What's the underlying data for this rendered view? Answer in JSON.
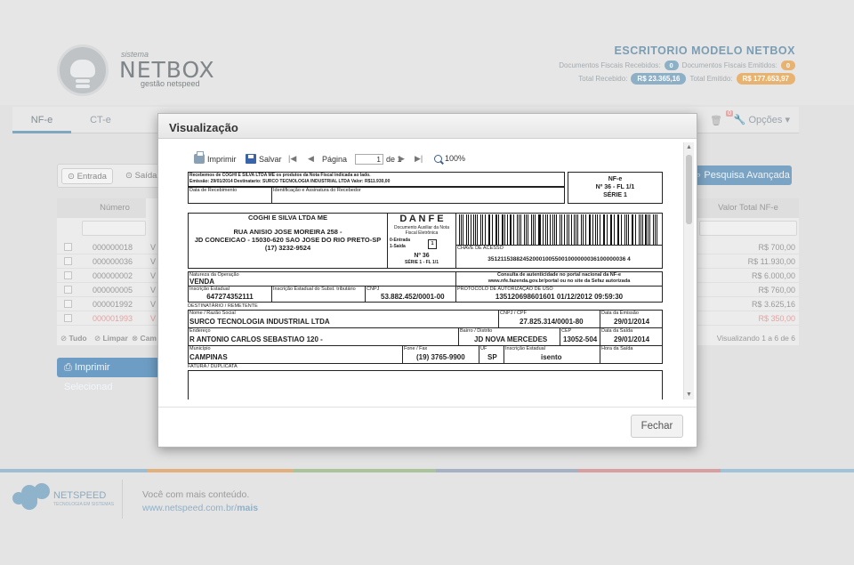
{
  "brand": {
    "small": "sistema",
    "name": "NETBOX",
    "sub": "gestão netspeed"
  },
  "office": {
    "title": "ESCRITORIO MODELO NETBOX",
    "docs_received_label": "Documentos Fiscais Recebidos:",
    "docs_received": "0",
    "docs_issued_label": "Documentos Fiscais Emitidos:",
    "docs_issued": "0",
    "total_received_label": "Total Recebido:",
    "total_received": "R$ 23.365,16",
    "total_issued_label": "Total Emitido:",
    "total_issued": "R$ 177.653,97"
  },
  "nav": {
    "tabs": [
      "NF-e",
      "CT-e"
    ],
    "options": "Opções",
    "badge": "0"
  },
  "filters": {
    "entrada": "Entrada",
    "saida": "Saída",
    "advanced": "Pesquisa Avançada"
  },
  "table": {
    "col_numero": "Número",
    "col_valor": "Valor Total NF-e",
    "rows": [
      {
        "num": "000000018",
        "v": "V",
        "val": "R$ 700,00",
        "red": false
      },
      {
        "num": "000000036",
        "v": "V",
        "val": "R$ 11.930,00",
        "red": false
      },
      {
        "num": "000000002",
        "v": "V",
        "val": "R$ 6.000,00",
        "red": false
      },
      {
        "num": "000000005",
        "v": "V",
        "val": "R$ 760,00",
        "red": false
      },
      {
        "num": "000001992",
        "v": "V",
        "val": "R$ 3.625,16",
        "red": false
      },
      {
        "num": "000001993",
        "v": "V",
        "val": "R$ 350,00",
        "red": true
      }
    ],
    "footer_tudo": "Tudo",
    "footer_limpar": "Limpar",
    "footer_cam": "Cam",
    "showing": "Visualizando 1 a 6 de 6",
    "print_selected": "Imprimir Selecionad"
  },
  "footer": {
    "brand": "NETSPEED",
    "tagline": "TECNOLOGIA EM SISTEMAS",
    "text": "Você com mais conteúdo.",
    "link_plain": "www.netspeed.com.br/",
    "link_bold": "mais"
  },
  "modal": {
    "title": "Visualização",
    "close": "Fechar",
    "toolbar": {
      "print": "Imprimir",
      "save": "Salvar",
      "page_label": "Página",
      "page_value": "1",
      "of": "de 1",
      "zoom": "100%"
    }
  },
  "danfe": {
    "receipt_line1": "Recebemos de COGHI E SILVA LTDA ME os produtos da Nota Fiscal indicada ao lado.",
    "receipt_line2": "Emissão: 29/01/2014 Destinatario: SURCO TECNOLOGIA INDUSTRIAL LTDA Valor: R$11.930,00",
    "data_recebimento": "Data de Recebimento",
    "identificacao": "Identificação e Assinatura do Recebedor",
    "nfe_label": "NF-e",
    "nfe_number": "Nº 36 - FL 1/1",
    "nfe_serie": "SÉRIE 1",
    "emitter_name": "COGHI E SILVA LTDA ME",
    "emitter_addr1": "RUA ANISIO JOSE MOREIRA 258 -",
    "emitter_addr2": "JD CONCEICAO - 15030-620 SAO JOSE DO RIO PRETO-SP",
    "emitter_phone": "(17) 3232-9524",
    "danfe_title": "D A N F E",
    "danfe_sub1": "Documento Auxiliar da Nota",
    "danfe_sub2": "Fiscal Eletrônica",
    "entrada": "0-Entrada",
    "saida": "1-Saída",
    "tipo": "1",
    "numero": "Nº 36",
    "serie_fl": "SÉRIE 1 - FL 1/1",
    "chave_label": "CHAVE DE ACESSO",
    "chave": "3512115388245200010055001000000036100000036 4",
    "consulta1": "Consulta de autenticidade no portal nacional da NF-e",
    "consulta2": "www.nfe.fazenda.gov.br/portal ou no site da Sefaz autorizada",
    "natureza_label": "Natureza da Operação",
    "natureza": "VENDA",
    "protocolo_label": "PROTOCOLO DE AUTORIZAÇÃO DE USO",
    "protocolo": "135120698601601 01/12/2012 09:59:30",
    "ie_label": "Inscrição Estadual",
    "ie": "647274352111",
    "ie_st_label": "Inscrição Estadual do Subst. tributário",
    "cnpj_label": "CNPJ",
    "cnpj": "53.882.452/0001-00",
    "dest_section": "DESTINATÁRIO / REMETENTE",
    "razao_label": "Nome / Razão Social",
    "razao": "SURCO TECNOLOGIA INDUSTRIAL LTDA",
    "dest_cnpj_label": "CNPJ / CPF",
    "dest_cnpj": "27.825.314/0001-80",
    "emissao_label": "Data da Emissão",
    "emissao": "29/01/2014",
    "endereco_label": "Endereço",
    "endereco": "R ANTONIO CARLOS SEBASTIAO 120 -",
    "bairro_label": "Bairro / Distrito",
    "bairro": "JD NOVA MERCEDES",
    "cep_label": "CEP",
    "cep": "13052-504",
    "data_saida_label": "Data da Saída",
    "data_saida": "29/01/2014",
    "municipio_label": "Município",
    "municipio": "CAMPINAS",
    "fone_label": "Fone / Fax",
    "fone": "(19) 3765-9900",
    "uf_label": "UF",
    "uf": "SP",
    "ie_dest_label": "Inscrição Estadual",
    "ie_dest": "isento",
    "hora_saida_label": "Hora da Saída",
    "fatura_label": "FATURA / DUPLICATA"
  },
  "colors": {
    "accent": "#6d9dc4",
    "orange": "#e8b371",
    "red_row": "#e4a3a1"
  }
}
